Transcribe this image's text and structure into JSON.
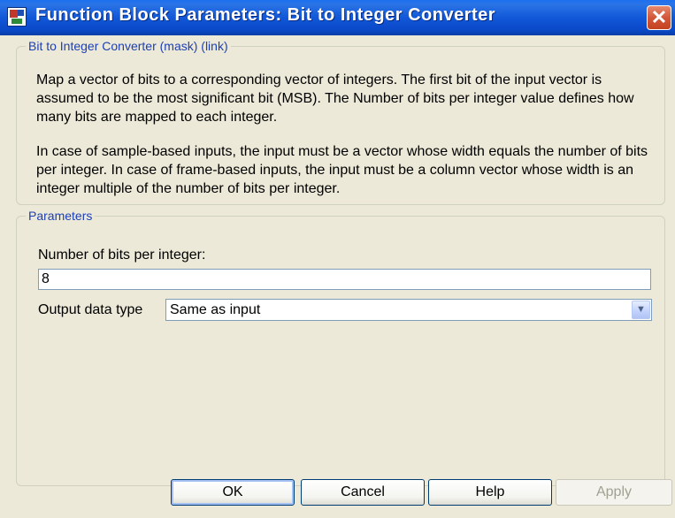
{
  "window": {
    "title": "Function Block Parameters: Bit to Integer Converter",
    "close_label": "✕"
  },
  "description_group": {
    "legend": "Bit to Integer Converter (mask) (link)",
    "paragraph1": "Map a vector of bits to a corresponding vector of integers. The first bit of the input vector is assumed to be the most significant bit (MSB). The Number of bits per integer value defines how many bits are mapped to each integer.",
    "paragraph2": "In case of sample-based inputs, the input must be a vector whose width equals the number of bits per integer. In case of frame-based inputs, the input must be a column vector whose width is an integer multiple of the number of bits per integer."
  },
  "parameters_group": {
    "legend": "Parameters",
    "bits_label": "Number of bits per integer:",
    "bits_value": "8",
    "output_type_label": "Output data type",
    "output_type_value": "Same as input"
  },
  "buttons": {
    "ok": "OK",
    "cancel": "Cancel",
    "help": "Help",
    "apply": "Apply"
  },
  "colors": {
    "titlebar": "#0a48c8",
    "legend_text": "#1c3fb5",
    "dialog_bg": "#ECE9D8"
  }
}
